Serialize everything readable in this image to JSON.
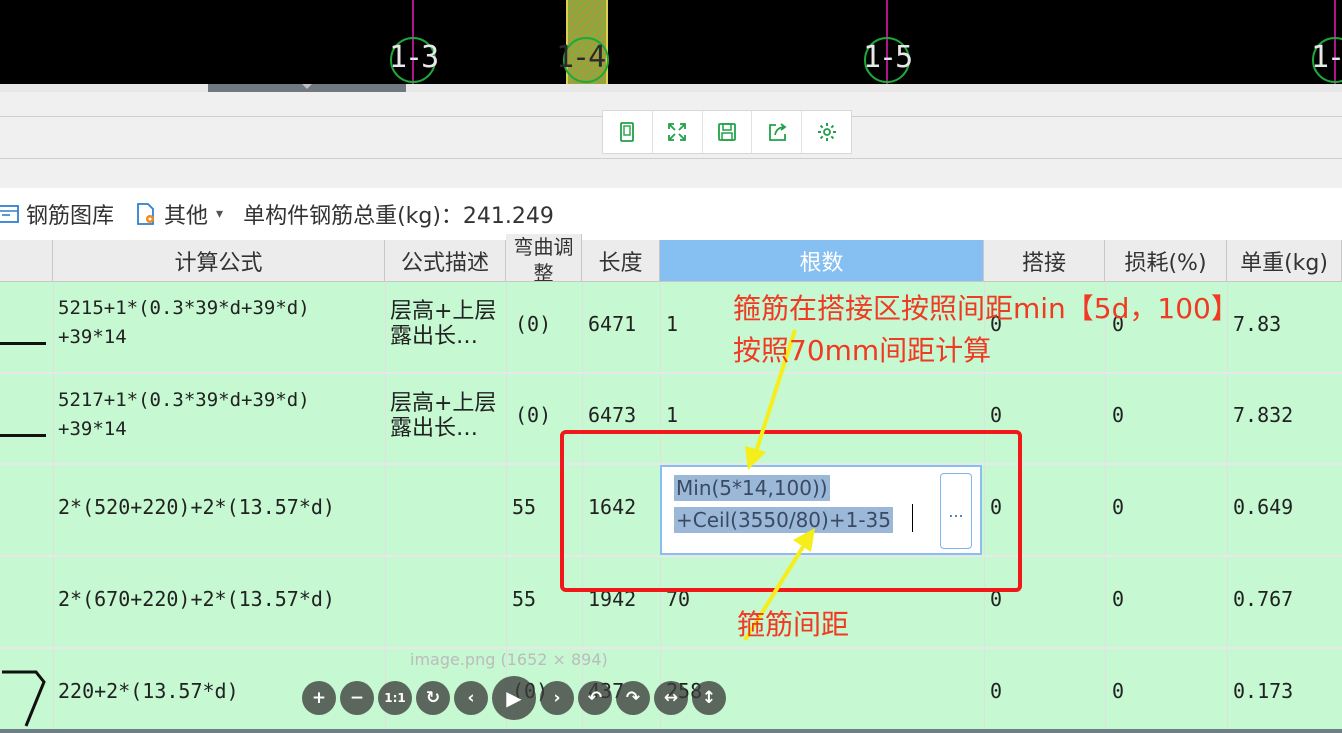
{
  "cad": {
    "axes": [
      "1-3",
      "1-4",
      "1-5",
      "1-"
    ]
  },
  "mini_toolbar": {
    "icons": [
      "fit-page-icon",
      "fullscreen-icon",
      "save-icon",
      "export-icon",
      "settings-icon"
    ]
  },
  "toolbar": {
    "library_label": "钢筋图库",
    "other_label": "其他",
    "other_caret": "▾",
    "total_weight_label": "单构件钢筋总重(kg)：241.249"
  },
  "columns": {
    "formula": "计算公式",
    "desc": "公式描述",
    "bend": "弯曲调整",
    "length": "长度",
    "count": "根数",
    "lap": "搭接",
    "loss": "损耗(%)",
    "unit_weight": "单重(kg)"
  },
  "rows": [
    {
      "formula": [
        "5215+1*(0.3*39*d+39*d)",
        "+39*14"
      ],
      "desc": [
        "层高+上层",
        "露出长…"
      ],
      "bend": "(0)",
      "length": "6471",
      "count": "1",
      "lap": "0",
      "loss": "0",
      "unit_weight": "7.83"
    },
    {
      "formula": [
        "5217+1*(0.3*39*d+39*d)",
        "+39*14"
      ],
      "desc": [
        "层高+上层",
        "露出长…"
      ],
      "bend": "(0)",
      "length": "6473",
      "count": "1",
      "lap": "0",
      "loss": "0",
      "unit_weight": "7.832"
    },
    {
      "formula": [
        "2*(520+220)+2*(13.57*d)"
      ],
      "desc": [],
      "bend": "55",
      "length": "1642",
      "count": "",
      "lap": "0",
      "loss": "0",
      "unit_weight": "0.649"
    },
    {
      "formula": [
        "2*(670+220)+2*(13.57*d)"
      ],
      "desc": [],
      "bend": "55",
      "length": "1942",
      "count": "70",
      "lap": "0",
      "loss": "0",
      "unit_weight": "0.767"
    },
    {
      "formula": [
        "220+2*(13.57*d)"
      ],
      "desc": [],
      "bend": "(0)",
      "length": "437",
      "count": "258",
      "lap": "0",
      "loss": "0",
      "unit_weight": "0.173"
    }
  ],
  "editor": {
    "line1": "Min(5*14,100))",
    "line2": "+Ceil(3550/80)+1-35",
    "button": "..."
  },
  "annotations": {
    "note1": "箍筋在搭接区按照间距min【5d，100】",
    "note2": "按照70mm间距计算",
    "note3": "箍筋间距"
  },
  "viewer": {
    "caption": "image.png (1652 × 894)",
    "buttons": [
      "+",
      "−",
      "1:1",
      "↻",
      "‹",
      "▶",
      "›",
      "↶",
      "↷",
      "↔",
      "↕"
    ]
  }
}
